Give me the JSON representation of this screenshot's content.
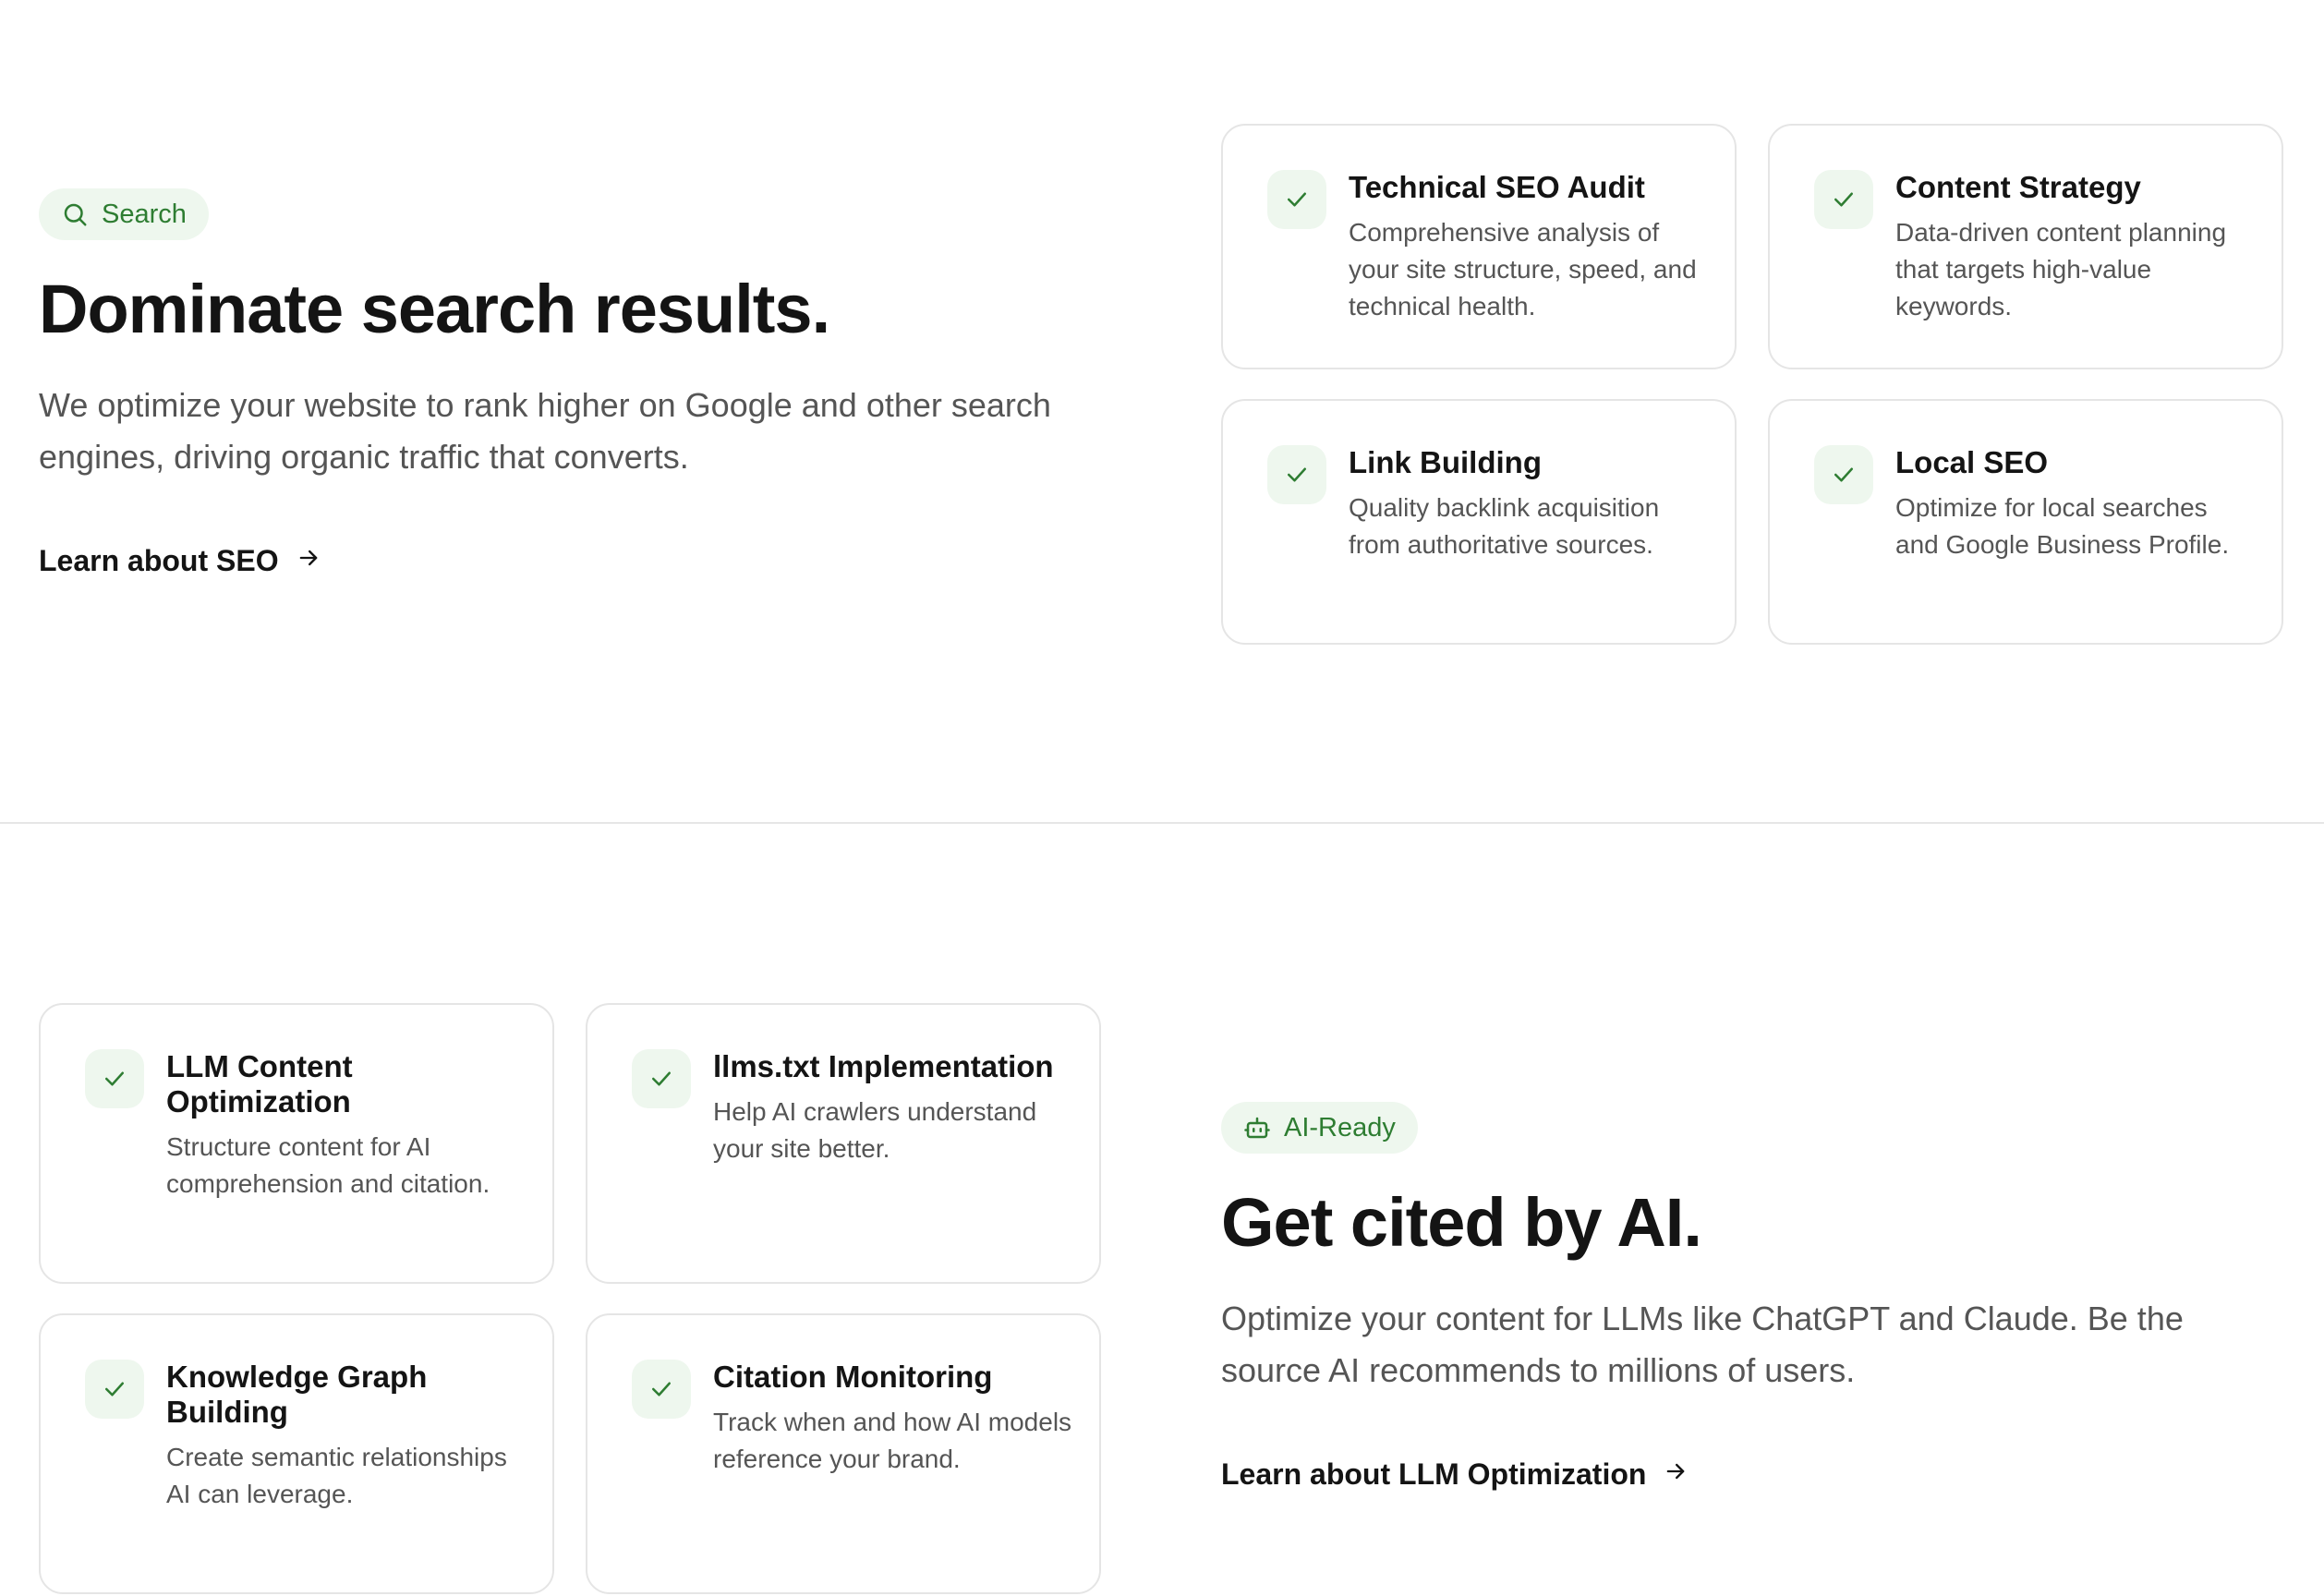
{
  "seo_section": {
    "badge_icon": "search-icon",
    "badge_label": "Search",
    "headline": "Dominate search results.",
    "lead": "We optimize your website to rank higher on Google and other search engines, driving organic traffic that converts.",
    "link_label": "Learn about SEO",
    "cards": [
      {
        "icon": "check-icon",
        "title": "Technical SEO Audit",
        "description": "Comprehensive analysis of your site structure, speed, and technical health."
      },
      {
        "icon": "check-icon",
        "title": "Content Strategy",
        "description": "Data-driven content planning that targets high-value keywords."
      },
      {
        "icon": "check-icon",
        "title": "Link Building",
        "description": "Quality backlink acquisition from authoritative sources."
      },
      {
        "icon": "check-icon",
        "title": "Local SEO",
        "description": "Optimize for local searches and Google Business Profile."
      }
    ]
  },
  "llm_section": {
    "badge_icon": "robot-icon",
    "badge_label": "AI-Ready",
    "headline": "Get cited by AI.",
    "lead": "Optimize your content for LLMs like ChatGPT and Claude. Be the source AI recommends to millions of users.",
    "link_label": "Learn about LLM Optimization",
    "cards": [
      {
        "icon": "check-icon",
        "title": "LLM Content Optimization",
        "description": "Structure content for AI comprehension and citation."
      },
      {
        "icon": "check-icon",
        "title": "llms.txt Implementation",
        "description": "Help AI crawlers understand your site better."
      },
      {
        "icon": "check-icon",
        "title": "Knowledge Graph Building",
        "description": "Create semantic relationships AI can leverage."
      },
      {
        "icon": "check-icon",
        "title": "Citation Monitoring",
        "description": "Track when and how AI models reference your brand."
      }
    ]
  },
  "colors": {
    "accent_green": "#2e7d32",
    "badge_bg": "#eef7ee",
    "text_dark": "#141414",
    "text_muted": "#555555",
    "border": "#e5e5e5"
  }
}
